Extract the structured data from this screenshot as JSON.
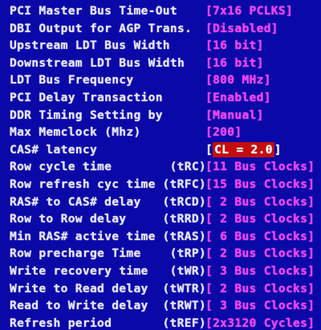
{
  "settings": [
    {
      "label": "PCI Master Bus Time-Out",
      "abbr": "",
      "value": "7x16 PCLKS"
    },
    {
      "label": "DBI Output for AGP Trans.",
      "abbr": "",
      "value": "Disabled"
    },
    {
      "label": "Upstream LDT Bus Width",
      "abbr": "",
      "value": "16 bit"
    },
    {
      "label": "Downstream LDT Bus Width",
      "abbr": "",
      "value": "16 bit"
    },
    {
      "label": "LDT Bus Frequency",
      "abbr": "",
      "value": "800 MHz"
    },
    {
      "label": "PCI Delay Transaction",
      "abbr": "",
      "value": "Enabled"
    },
    {
      "label": "DDR Timing Setting by",
      "abbr": "",
      "value": "Manual"
    },
    {
      "label": "Max Memclock (Mhz)",
      "abbr": "",
      "value": "200"
    },
    {
      "label": "CAS# latency",
      "abbr": "",
      "value": "CL = 2.0",
      "selected": true
    },
    {
      "label": "Row cycle time",
      "abbr": "(tRC)",
      "value": "11 Bus Clocks"
    },
    {
      "label": "Row refresh cyc time",
      "abbr": "(tRFC)",
      "value": "15 Bus Clocks"
    },
    {
      "label": "RAS# to CAS# delay",
      "abbr": "(tRCD)",
      "value": " 2 Bus Clocks"
    },
    {
      "label": "Row to Row delay",
      "abbr": "(tRRD)",
      "value": " 2 Bus Clocks"
    },
    {
      "label": "Min RAS# active time",
      "abbr": "(tRAS)",
      "value": " 6 Bus Clocks"
    },
    {
      "label": "Row precharge Time",
      "abbr": "(tRP)",
      "value": " 2 Bus Clocks"
    },
    {
      "label": "Write recovery time",
      "abbr": "(tWR)",
      "value": " 3 Bus Clocks"
    },
    {
      "label": "Write to Read delay",
      "abbr": "(tWTR)",
      "value": " 2 Bus Clocks"
    },
    {
      "label": "Read to Write delay",
      "abbr": "(tRWT)",
      "value": " 3 Bus Clocks"
    },
    {
      "label": "Refresh period",
      "abbr": "(tREF)",
      "value": "2x3120 Cycles"
    }
  ],
  "colors": {
    "background": "#0b08a8",
    "label": "#e4e4ff",
    "value": "#ff3cf5",
    "selection": "#c40d0d"
  }
}
